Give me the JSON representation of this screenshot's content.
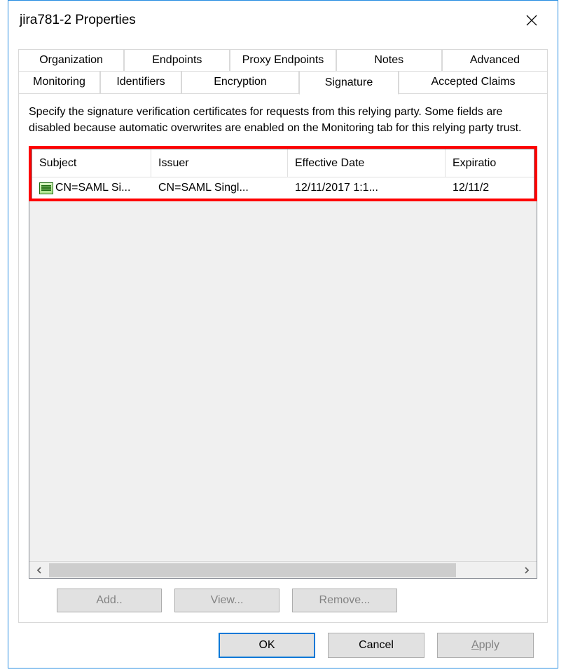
{
  "window": {
    "title": "jira781-2 Properties"
  },
  "tabs": {
    "row1": [
      "Organization",
      "Endpoints",
      "Proxy Endpoints",
      "Notes",
      "Advanced"
    ],
    "row2": [
      "Monitoring",
      "Identifiers",
      "Encryption",
      "Signature",
      "Accepted Claims"
    ],
    "active": "Signature"
  },
  "panel": {
    "description": "Specify the signature verification certificates for requests from this relying party. Some fields are disabled because automatic overwrites are enabled on the Monitoring tab for this relying party trust."
  },
  "table": {
    "columns": [
      "Subject",
      "Issuer",
      "Effective Date",
      "Expiratio"
    ],
    "rows": [
      {
        "subject": "CN=SAML Si...",
        "issuer": "CN=SAML Singl...",
        "effective": "12/11/2017 1:1...",
        "expiration": "12/11/2"
      }
    ]
  },
  "actions": {
    "add": "Add..",
    "view": "View...",
    "remove": "Remove..."
  },
  "dialog": {
    "ok": "OK",
    "cancel": "Cancel",
    "apply": "Apply"
  }
}
